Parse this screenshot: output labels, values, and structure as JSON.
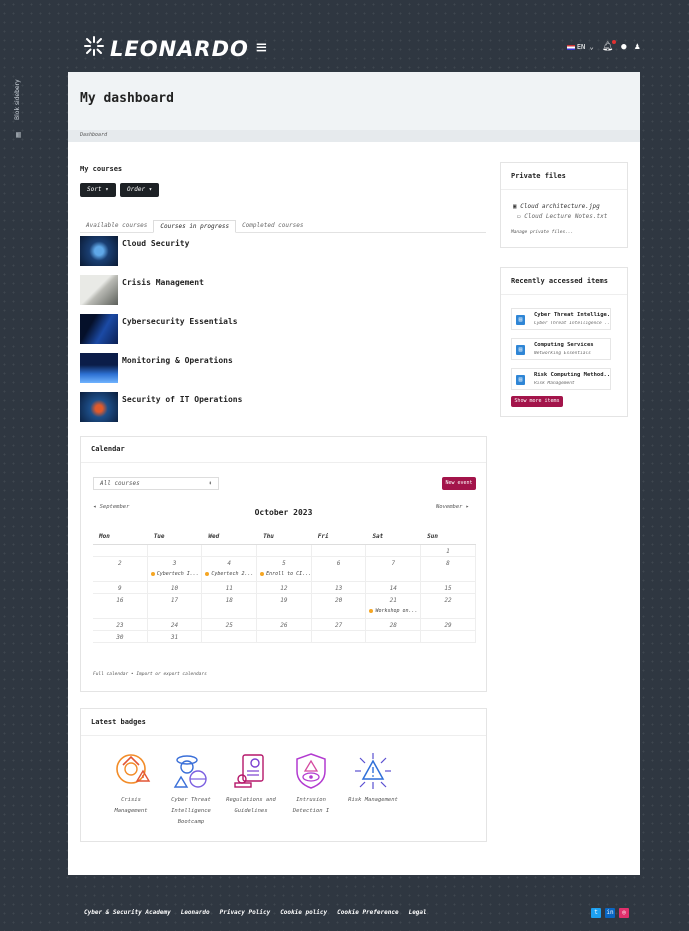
{
  "colors": {
    "accent": "#a3144a",
    "dark": "#1d2125",
    "event_dot": "#f5a623",
    "icon_blue": "#2f86d6"
  },
  "drawer": {
    "label": "Blok sidebery"
  },
  "header": {
    "brand": "LEONARDO",
    "lang": "EN"
  },
  "page": {
    "title": "My dashboard",
    "breadcrumb": "Dashboard"
  },
  "courses": {
    "title": "My courses",
    "sort_label": "Sort",
    "order_label": "Order",
    "tabs": [
      "Available courses",
      "Courses in progress",
      "Completed courses"
    ],
    "active_tab": 1,
    "items": [
      {
        "name": "Cloud Security"
      },
      {
        "name": "Crisis Management"
      },
      {
        "name": "Cybersecurity Essentials"
      },
      {
        "name": "Monitoring & Operations"
      },
      {
        "name": "Security of IT Operations"
      }
    ]
  },
  "private_files": {
    "title": "Private files",
    "files": [
      "Cloud architecture.jpg",
      "Cloud Lecture Notes.txt"
    ],
    "manage_link": "Manage private files..."
  },
  "recent": {
    "title": "Recently accessed items",
    "items": [
      {
        "title": "Cyber Threat Intellige...",
        "sub": "Cyber Threat Intelligence ..."
      },
      {
        "title": "Computing Services",
        "sub": "Networking Essentials"
      },
      {
        "title": "Risk Computing Method...",
        "sub": "Risk Management"
      }
    ],
    "more_button": "Show more items"
  },
  "calendar": {
    "title": "Calendar",
    "filter": "All courses",
    "new_event": "New event",
    "prev": "September",
    "month": "October 2023",
    "next": "November",
    "days": [
      "Mon",
      "Tue",
      "Wed",
      "Thu",
      "Fri",
      "Sat",
      "Sun"
    ],
    "weeks": [
      [
        {
          "d": ""
        },
        {
          "d": ""
        },
        {
          "d": ""
        },
        {
          "d": ""
        },
        {
          "d": ""
        },
        {
          "d": ""
        },
        {
          "d": "1"
        }
      ],
      [
        {
          "d": "2"
        },
        {
          "d": "3",
          "ev": "Cybertech I..."
        },
        {
          "d": "4",
          "ev": "Cybertech 2..."
        },
        {
          "d": "5",
          "ev": "Enroll to CI..."
        },
        {
          "d": "6"
        },
        {
          "d": "7"
        },
        {
          "d": "8"
        }
      ],
      [
        {
          "d": "9"
        },
        {
          "d": "10"
        },
        {
          "d": "11"
        },
        {
          "d": "12"
        },
        {
          "d": "13"
        },
        {
          "d": "14"
        },
        {
          "d": "15"
        }
      ],
      [
        {
          "d": "16"
        },
        {
          "d": "17"
        },
        {
          "d": "18"
        },
        {
          "d": "19"
        },
        {
          "d": "20"
        },
        {
          "d": "21",
          "ev": "Workshop on..."
        },
        {
          "d": "22"
        }
      ],
      [
        {
          "d": "23"
        },
        {
          "d": "24"
        },
        {
          "d": "25"
        },
        {
          "d": "26"
        },
        {
          "d": "27"
        },
        {
          "d": "28"
        },
        {
          "d": "29"
        }
      ],
      [
        {
          "d": "30"
        },
        {
          "d": "31"
        },
        {
          "d": ""
        },
        {
          "d": ""
        },
        {
          "d": ""
        },
        {
          "d": ""
        },
        {
          "d": ""
        }
      ]
    ],
    "footer_links": "Full calendar • Import or export calendars"
  },
  "badges": {
    "title": "Latest badges",
    "items": [
      {
        "l1": "Crisis",
        "l2": "Management",
        "l3": ""
      },
      {
        "l1": "Cyber Threat",
        "l2": "Intelligence",
        "l3": "Bootcamp"
      },
      {
        "l1": "Regulations and",
        "l2": "Guidelines",
        "l3": ""
      },
      {
        "l1": "Intrusion",
        "l2": "Detection I",
        "l3": ""
      },
      {
        "l1": "Risk Management",
        "l2": "",
        "l3": ""
      }
    ]
  },
  "footer": {
    "links": [
      "Cyber & Security Academy",
      "Leonardo",
      "Privacy Policy",
      "Cookie policy",
      "Cookie Preference",
      "Legal"
    ],
    "social": [
      "twitter-icon",
      "linkedin-icon",
      "instagram-icon"
    ]
  }
}
